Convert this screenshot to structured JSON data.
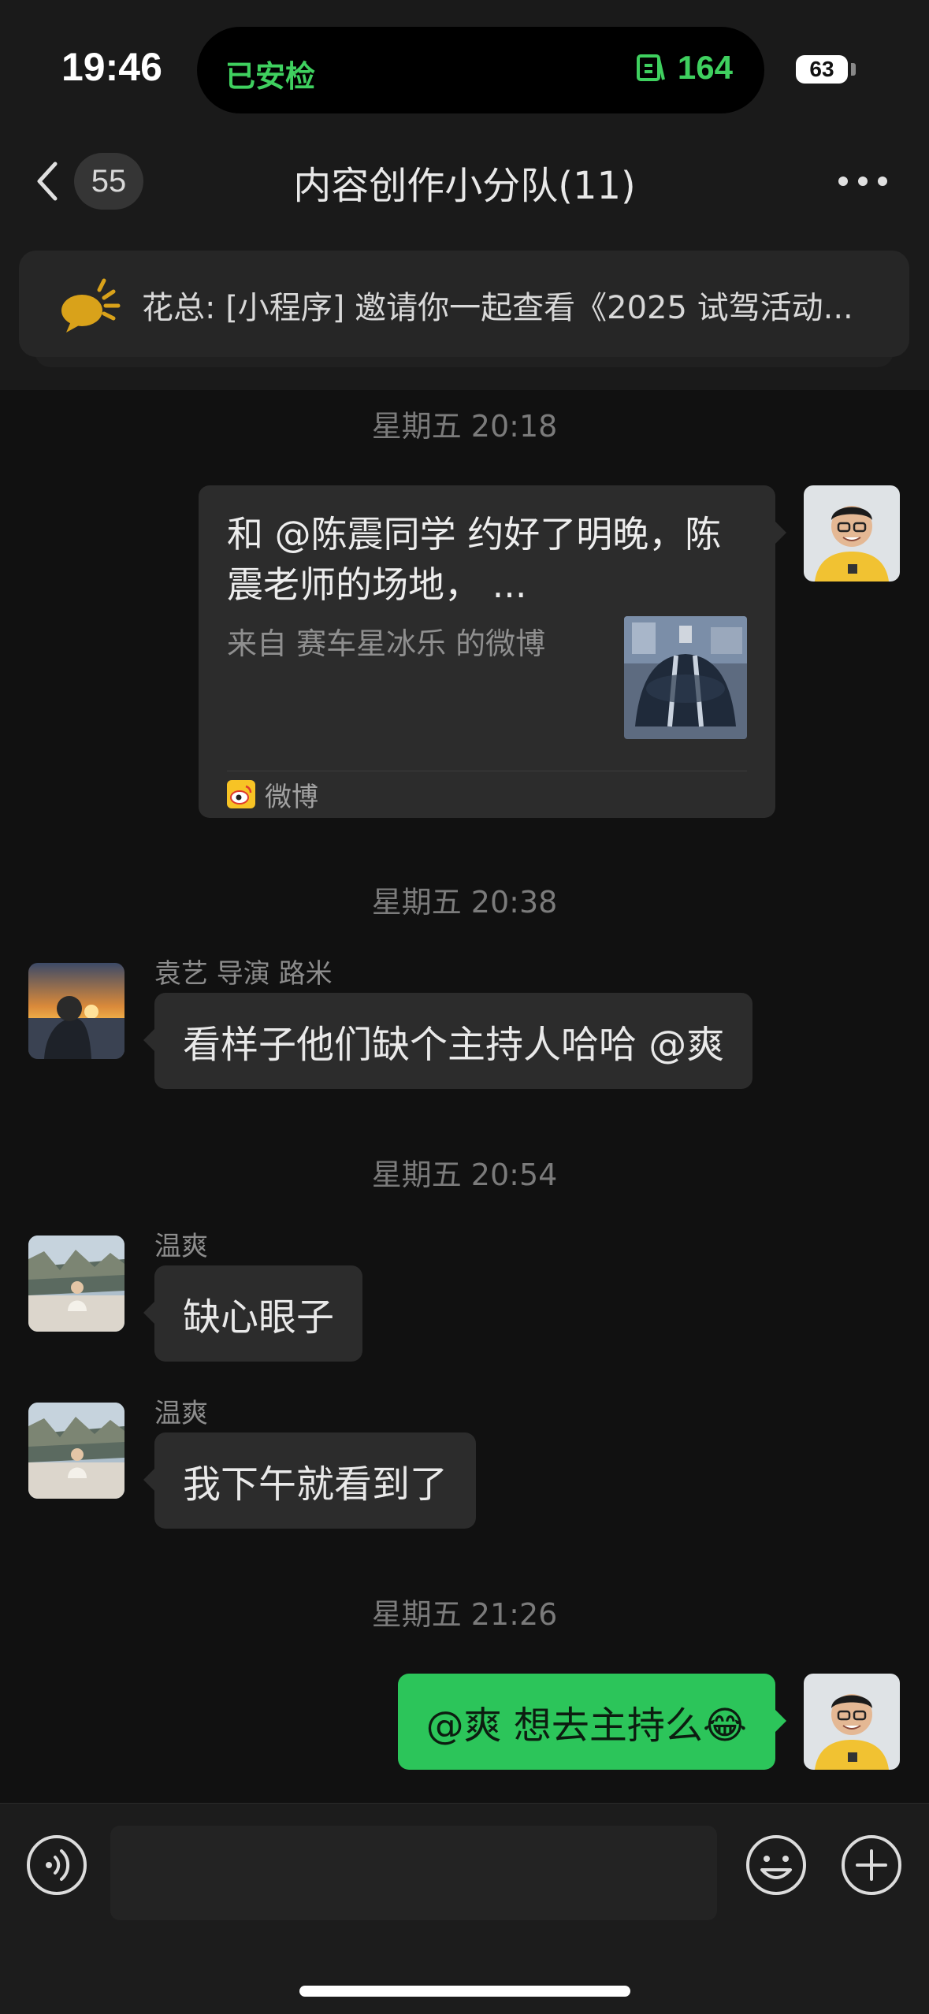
{
  "status_bar": {
    "time": "19:46",
    "island_left": "已安检",
    "island_right_value": "164",
    "battery": "63"
  },
  "nav": {
    "back_badge": "55",
    "title": "内容创作小分队(11)"
  },
  "pinned": {
    "text": "花总: [小程序] 邀请你一起查看《2025 试驾活动..."
  },
  "messages": [
    {
      "timestamp": "星期五 20:18",
      "card": {
        "title": "和 @陈震同学 约好了明晚，陈震老师的场地，  ...",
        "source": "来自 赛车星冰乐 的微博",
        "app": "微博"
      }
    },
    {
      "timestamp": "星期五 20:38",
      "sender": "袁艺 导演 路米",
      "text": "看样子他们缺个主持人哈哈 @爽"
    },
    {
      "timestamp": "星期五 20:54",
      "sender": "温爽",
      "text": "缺心眼子"
    },
    {
      "sender": "温爽",
      "text": "我下午就看到了"
    },
    {
      "timestamp": "星期五 21:26",
      "text": "@爽 想去主持么😂"
    }
  ],
  "icons": {
    "back": "chevron-left-icon",
    "more": "more-dots-icon",
    "pinned": "megaphone-icon",
    "voice": "voice-icon",
    "emoji": "emoji-icon",
    "plus": "plus-icon"
  },
  "colors": {
    "accent_green": "#2cc55a",
    "island_green": "#3fd05f",
    "background": "#111111",
    "bubble": "#2c2c2c"
  }
}
